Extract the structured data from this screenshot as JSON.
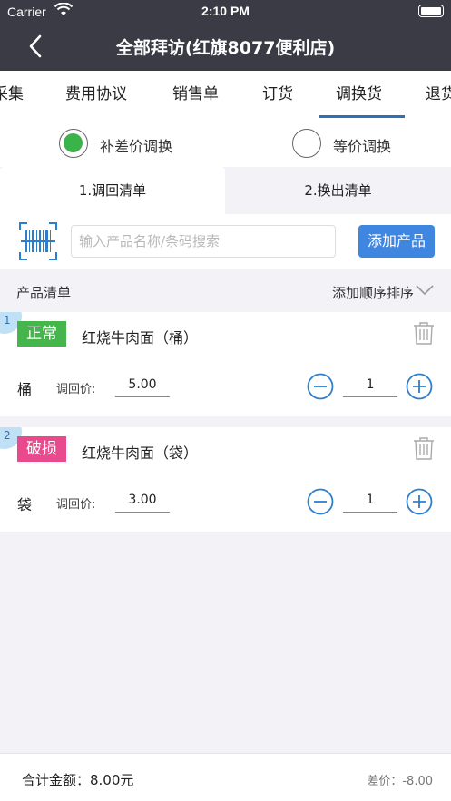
{
  "status_bar": {
    "carrier": "Carrier",
    "time": "2:10 PM"
  },
  "nav": {
    "title": "全部拜访(红旗8077便利店)"
  },
  "tabs": [
    {
      "label": "采集"
    },
    {
      "label": "费用协议"
    },
    {
      "label": "销售单"
    },
    {
      "label": "订货"
    },
    {
      "label": "调换货"
    },
    {
      "label": "退货"
    }
  ],
  "active_tab": "调换货",
  "exchange_mode": {
    "options": [
      "补差价调换",
      "等价调换"
    ],
    "selected": "补差价调换"
  },
  "sub_tabs": [
    "1.调回清单",
    "2.换出清单"
  ],
  "search": {
    "placeholder": "输入产品名称/条码搜索",
    "add_button": "添加产品"
  },
  "list": {
    "title": "产品清单",
    "sort_label": "添加顺序排序"
  },
  "items": [
    {
      "index": "1",
      "status": "正常",
      "name": "红烧牛肉面（桶）",
      "unit": "桶",
      "price_label": "调回价:",
      "price": "5.00",
      "qty": "1"
    },
    {
      "index": "2",
      "status": "破损",
      "name": "红烧牛肉面（袋）",
      "unit": "袋",
      "price_label": "调回价:",
      "price": "3.00",
      "qty": "1"
    }
  ],
  "footer": {
    "total": "合计金额：8.00元",
    "diff": "差价：-8.00"
  },
  "colors": {
    "header": "#3a3b45",
    "accent": "#2f6fb7",
    "button": "#3f86e0",
    "normal": "#45b54c",
    "damaged": "#e84a8d"
  }
}
